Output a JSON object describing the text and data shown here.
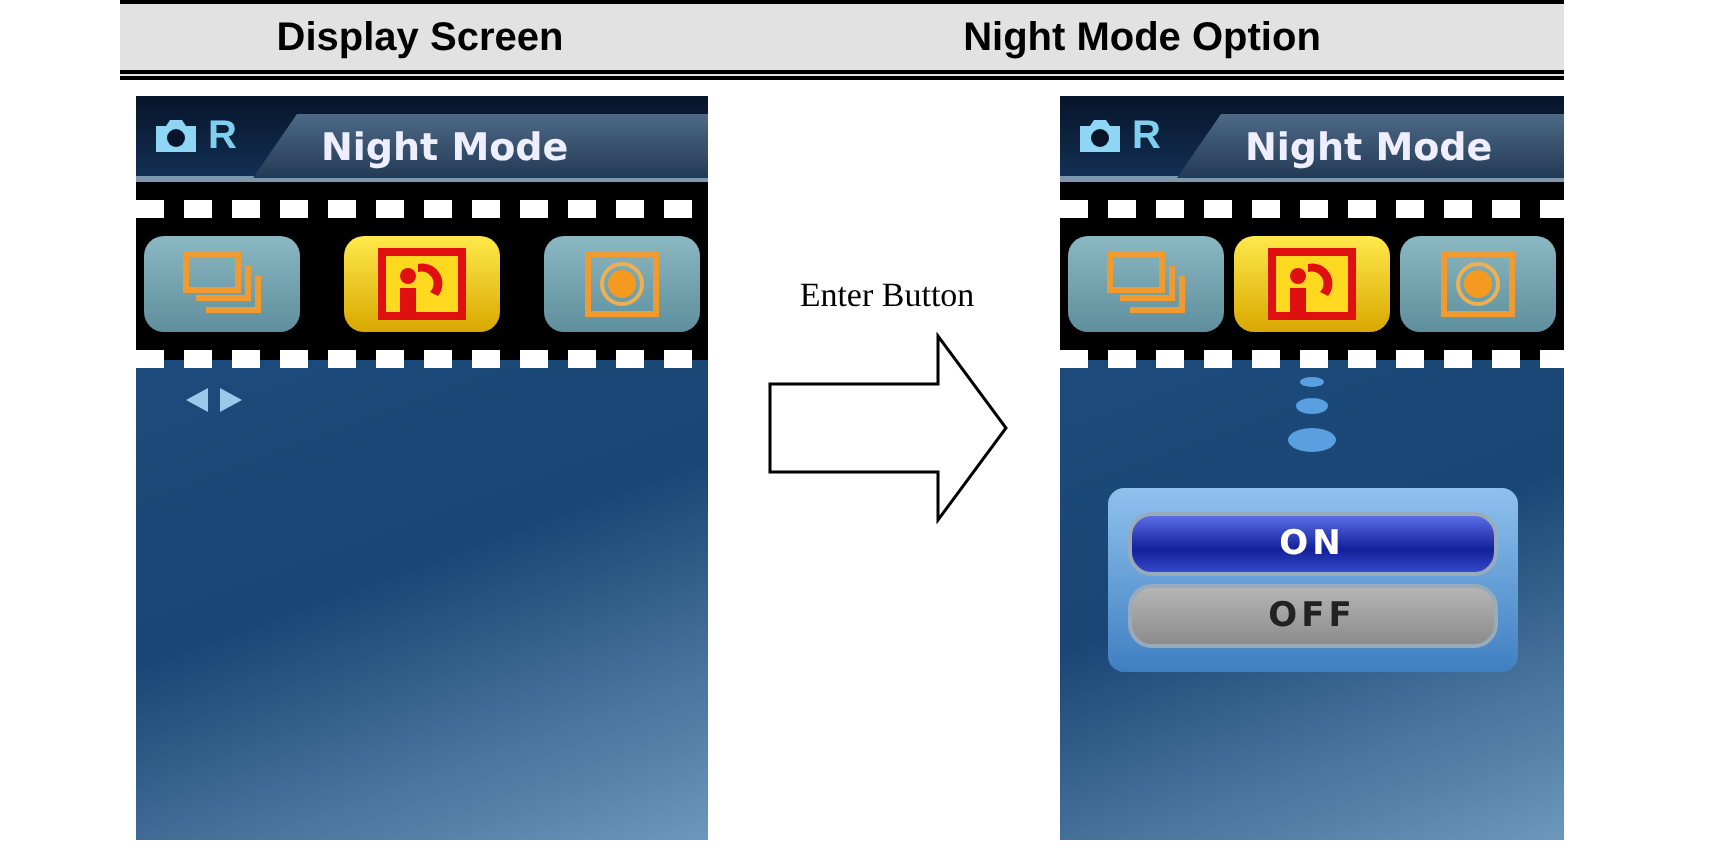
{
  "columns": [
    {
      "heading": "Display Screen"
    },
    {
      "heading": "Night Mode Option"
    }
  ],
  "transition": {
    "label": "Enter Button"
  },
  "screens": [
    {
      "kind": "browse",
      "mode_letter": "R",
      "title": "Night Mode",
      "modes": [
        {
          "kind": "burst",
          "selected": false
        },
        {
          "kind": "night",
          "selected": true
        },
        {
          "kind": "target",
          "selected": false
        }
      ]
    },
    {
      "kind": "options",
      "mode_letter": "R",
      "title": "Night Mode",
      "modes": [
        {
          "kind": "burst",
          "selected": false
        },
        {
          "kind": "night",
          "selected": true
        },
        {
          "kind": "target",
          "selected": false
        }
      ],
      "options": [
        {
          "label": "ON",
          "selected": true
        },
        {
          "label": "OFF",
          "selected": false
        }
      ]
    }
  ]
}
